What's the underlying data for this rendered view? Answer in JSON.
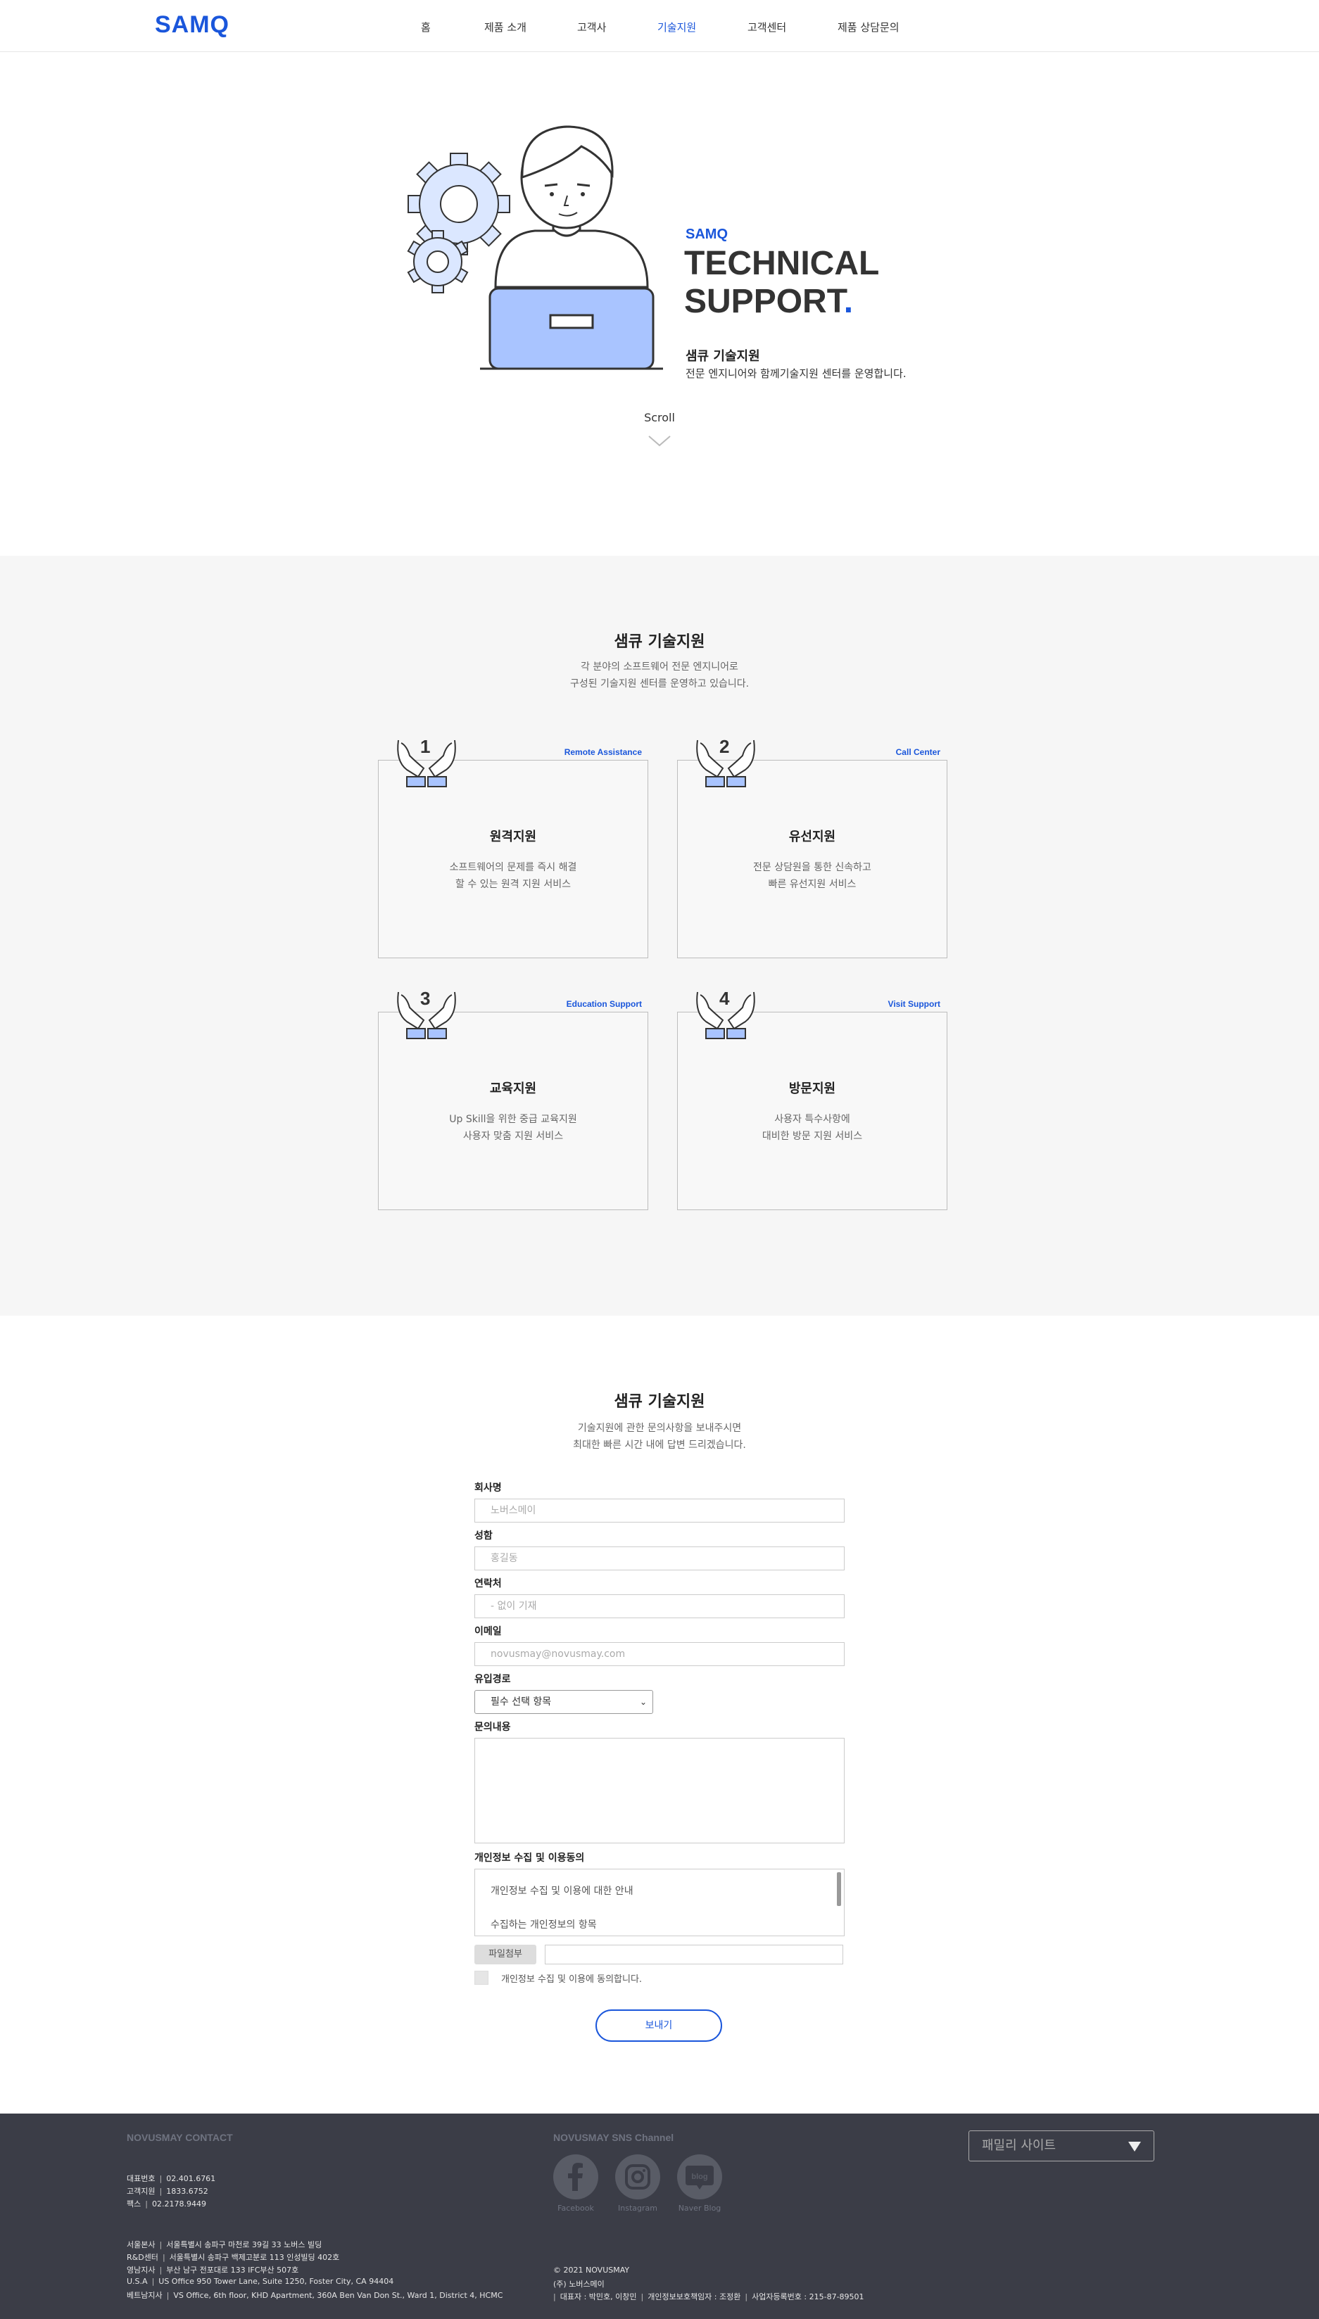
{
  "header": {
    "logo": "SAMQ",
    "nav": [
      "홈",
      "제품 소개",
      "고객사",
      "기술지원",
      "고객센터",
      "제품 상담문의"
    ],
    "active_index": 3
  },
  "hero": {
    "brand": "SAMQ",
    "title_line1": "TECHNICAL",
    "title_line2": "SUPPORT",
    "title_dot": ".",
    "subtitle": "샘큐 기술지원",
    "description": "전문 엔지니어와 함께기술지원 센터를 운영합니다.",
    "scroll": "Scroll"
  },
  "services": {
    "title": "샘큐 기술지원",
    "desc_line1": "각 분야의 소프트웨어 전문 엔지니어로",
    "desc_line2": "구성된 기술지원 센터를 운영하고 있습니다.",
    "cards": [
      {
        "num": "1",
        "eng": "Remote Assistance",
        "title": "원격지원",
        "desc1": "소프트웨어의 문제를 즉시 해결",
        "desc2": "할 수 있는 원격 지원 서비스"
      },
      {
        "num": "2",
        "eng": "Call Center",
        "title": "유선지원",
        "desc1": "전문 상담원을 통한 신속하고",
        "desc2": "빠른 유선지원 서비스"
      },
      {
        "num": "3",
        "eng": "Education Support",
        "title": "교육지원",
        "desc1": "Up Skill을 위한 중급 교육지원",
        "desc2": "사용자 맞춤 지원 서비스"
      },
      {
        "num": "4",
        "eng": "Visit Support",
        "title": "방문지원",
        "desc1": "사용자 특수사항에",
        "desc2": "대비한 방문 지원 서비스"
      }
    ]
  },
  "form": {
    "title": "샘큐 기술지원",
    "desc_line1": "기술지원에 관한 문의사항을 보내주시면",
    "desc_line2": "최대한 빠른 시간 내에 답변 드리겠습니다.",
    "company_label": "회사명",
    "company_placeholder": "노버스메이",
    "name_label": "성함",
    "name_placeholder": "홍길동",
    "phone_label": "연락처",
    "phone_placeholder": "- 없이 기재",
    "email_label": "이메일",
    "email_placeholder": "novusmay@novusmay.com",
    "source_label": "유입경로",
    "source_value": "필수 선택 항목",
    "inquiry_label": "문의내용",
    "privacy_label": "개인정보 수집 및 이용동의",
    "privacy_line1": "개인정보 수집 및 이용에 대한 안내",
    "privacy_line2": "수집하는 개인정보의 항목",
    "file_button": "파일첨부",
    "agree_label": "개인정보 수집 및 이용에 동의합니다.",
    "submit": "보내기"
  },
  "footer": {
    "contact_head": "NOVUSMAY CONTACT",
    "sns_head": "NOVUSMAY SNS Channel",
    "contacts": [
      {
        "label": "대표번호",
        "value": "02.401.6761"
      },
      {
        "label": "고객지원",
        "value": "1833.6752"
      },
      {
        "label": "팩스",
        "value": "02.2178.9449"
      }
    ],
    "addresses": [
      {
        "label": "서울본사",
        "value": "서울특별시 송파구 마천로 39길 33 노버스 빌딩"
      },
      {
        "label": "R&D센터",
        "value": "서울특별시 송파구 백제고분로 113 인성빌딩 402호"
      },
      {
        "label": "영남지사",
        "value": "부산 남구 전포대로 133 IFC부산 507호"
      },
      {
        "label": "U.S.A",
        "value": "US Office 950 Tower Lane, Suite 1250, Foster City, CA 94404"
      },
      {
        "label": "베트남지사",
        "value": "VS Office, 6th floor, KHD Apartment, 360A Ben Van Don St., Ward 1, District 4, HCMC"
      }
    ],
    "sns": [
      "Facebook",
      "Instagram",
      "Naver Blog"
    ],
    "family_site": "패밀리 사이트",
    "copyright": "© 2021 NOVUSMAY",
    "company_name": "(주) 노버스메이",
    "biz_ceo": "대표자 : 박민호, 이창민",
    "biz_privacy": "개인정보보호책임자 : 조정환",
    "biz_reg": "사업자등록번호 : 215-87-89501"
  }
}
